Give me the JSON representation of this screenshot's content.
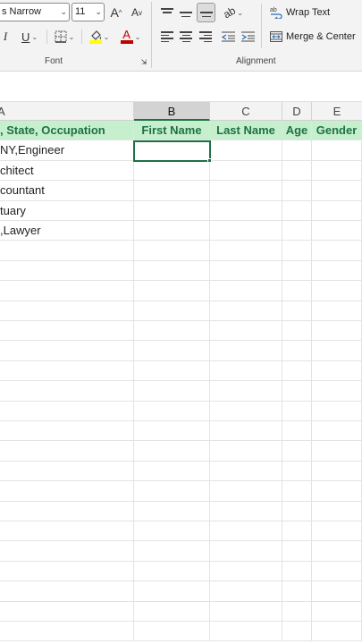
{
  "ribbon": {
    "font_group": {
      "font_name": "s Narrow",
      "font_size": "11",
      "grow_font": "A",
      "shrink_font": "A",
      "italic": "I",
      "underline": "U",
      "font_color_glyph": "A",
      "label": "Font",
      "fill_color": "#ffff00",
      "font_color": "#c00000"
    },
    "alignment_group": {
      "wrap_text_label": "Wrap Text",
      "merge_center_label": "Merge & Center",
      "label": "Alignment"
    }
  },
  "grid": {
    "columns": [
      "B",
      "C",
      "D",
      "E"
    ],
    "selected_column": "B",
    "header_row": {
      "a": ", State, Occupation",
      "b": "First Name",
      "c": "Last Name",
      "d": "Age",
      "e": "Gender"
    },
    "rows": [
      {
        "a": "NY,Engineer"
      },
      {
        "a": "chitect"
      },
      {
        "a": "countant"
      },
      {
        "a": "tuary"
      },
      {
        "a": ",Lawyer"
      }
    ],
    "header_fill": "#c6efce",
    "header_text_color": "#1e7145",
    "selection_color": "#1e7145"
  }
}
